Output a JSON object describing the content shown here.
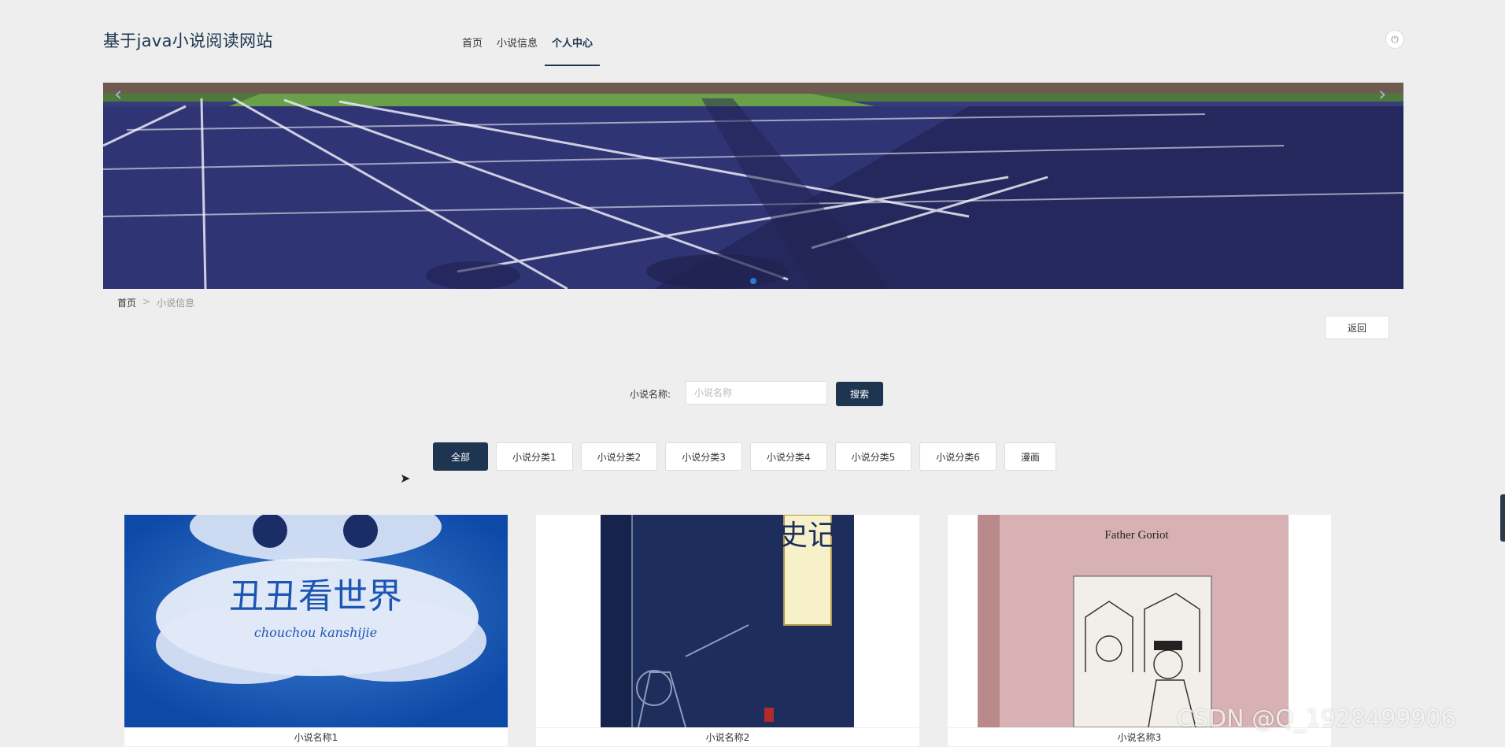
{
  "header": {
    "site_title": "基于java小说阅读网站",
    "nav": [
      {
        "label": "首页",
        "active": false
      },
      {
        "label": "小说信息",
        "active": false
      },
      {
        "label": "个人中心",
        "active": true
      }
    ]
  },
  "breadcrumb": {
    "home": "首页",
    "separator": ">",
    "current": "小说信息"
  },
  "actions": {
    "back_label": "返回"
  },
  "search": {
    "label": "小说名称:",
    "placeholder": "小说名称",
    "value": "",
    "button_label": "搜索"
  },
  "categories": [
    "全部",
    "小说分类1",
    "小说分类2",
    "小说分类3",
    "小说分类4",
    "小说分类5",
    "小说分类6",
    "漫画"
  ],
  "novels": [
    {
      "title": "小说名称1",
      "cover_text": "丑丑看世界",
      "cover_subtext": "chouchou kanshijie"
    },
    {
      "title": "小说名称2",
      "cover_text": "史记"
    },
    {
      "title": "小说名称3",
      "cover_text": "Father Goriot"
    }
  ],
  "watermark": "CSDN @Q_1928499906",
  "colors": {
    "primary": "#1d3550",
    "background": "#eeeeee",
    "dot": "#2a7ad6"
  }
}
